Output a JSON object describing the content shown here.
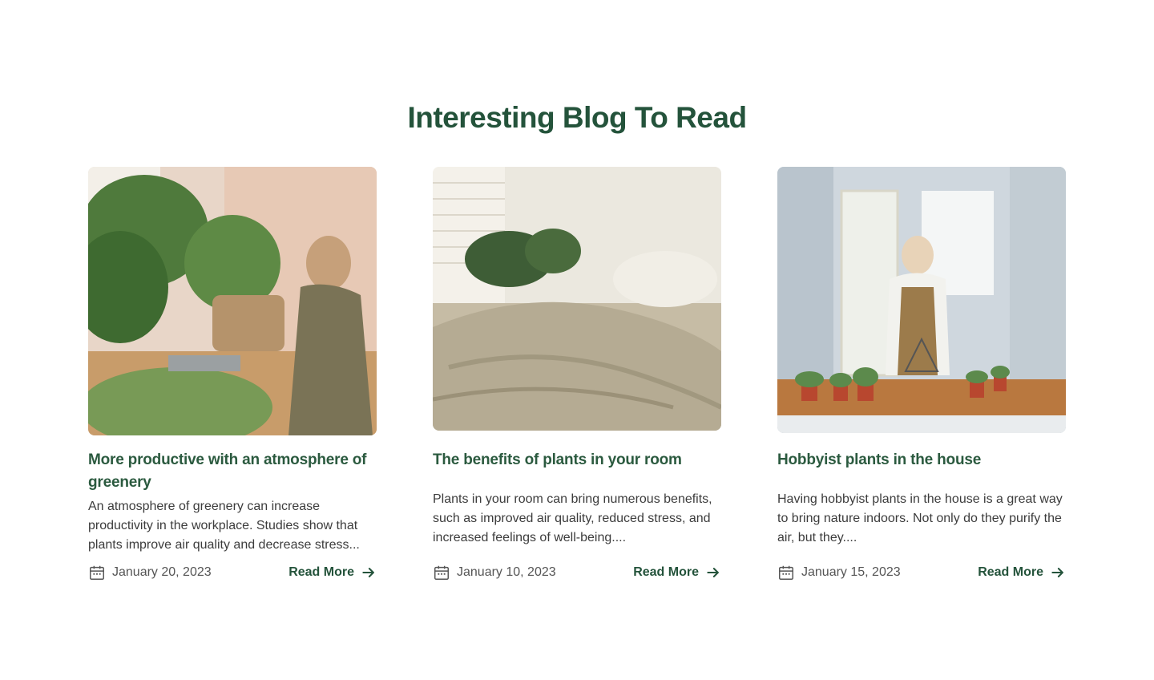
{
  "section": {
    "title": "Interesting Blog To Read"
  },
  "colors": {
    "accent": "#24533b",
    "title": "#2b5a3f",
    "text": "#3c3c3c",
    "muted": "#555555"
  },
  "icons": {
    "date": "calendar-icon",
    "link": "arrow-right-icon"
  },
  "posts": [
    {
      "title": "More productive with an atmosphere of greenery",
      "excerpt": "An atmosphere of greenery can increase productivity in the workplace. Studies show that plants improve air quality and decrease stress...",
      "date": "January 20, 2023",
      "cta": "Read More"
    },
    {
      "title": "The benefits of plants in your room",
      "excerpt": "Plants in your room can bring numerous benefits, such as improved air quality, reduced stress, and increased feelings of well-being....",
      "date": "January 10, 2023",
      "cta": "Read More"
    },
    {
      "title": "Hobbyist plants in the house",
      "excerpt": "Having hobbyist plants in the house is a great way to bring nature indoors. Not only do they purify the air, but they....",
      "date": "January 15, 2023",
      "cta": "Read More"
    }
  ]
}
